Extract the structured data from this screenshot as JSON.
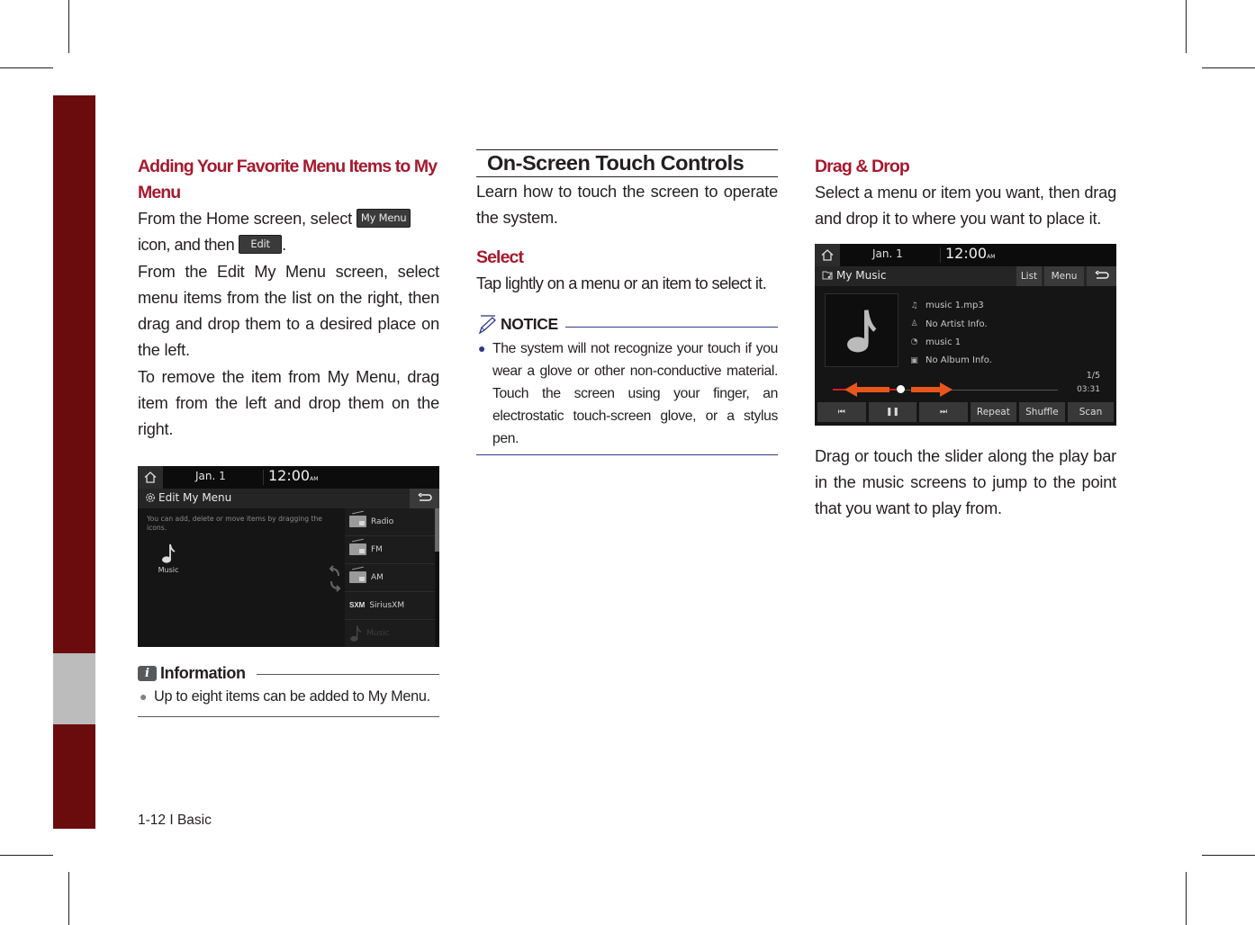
{
  "page": {
    "footer": "1-12 I Basic",
    "colors": {
      "heading_red": "#a6192e",
      "side_tab_red": "#6a0c0e",
      "side_tab_gray": "#bcbcbc",
      "notice_blue": "#2e3a87",
      "screen_bg": "#151515",
      "drag_arrow_orange": "#e8561b"
    }
  },
  "left_column": {
    "heading": "Adding Your Favorite Menu Items to My Menu",
    "para1_before": "From the Home screen, select",
    "my_menu_button": "My Menu",
    "para1_mid": "icon, and then",
    "edit_button": "Edit",
    "para1_end": ".",
    "para2": "From the Edit My Menu screen, select menu items from the list on the right, then drag and drop them to a desired place on the left.",
    "para3": "To remove the item from My Menu, drag item from the left and drop them on the right.",
    "screenshot": {
      "date": "Jan.  1",
      "time": "12:00",
      "ampm": "AM",
      "title": "Edit My Menu",
      "hint": "You can add, delete or move items by dragging the icons.",
      "left_tiles": [
        {
          "label": "Music",
          "icon": "music-note-icon"
        }
      ],
      "list_items": [
        {
          "label": "Radio",
          "icon": "radio-icon",
          "dimmed": false
        },
        {
          "label": "FM",
          "icon": "radio-icon",
          "dimmed": false
        },
        {
          "label": "AM",
          "icon": "radio-icon",
          "dimmed": false
        },
        {
          "label": "SiriusXM",
          "icon": "sxm-logo-icon",
          "logo_text": "SXM",
          "dimmed": false
        },
        {
          "label": "Music",
          "icon": "music-note-icon",
          "dimmed": true
        }
      ]
    },
    "information": {
      "label": "Information",
      "items": [
        "Up to eight items can be added to My Menu."
      ]
    }
  },
  "middle_column": {
    "section_title": "On-Screen Touch Controls",
    "intro": "Learn how to touch the screen to operate the system.",
    "select_heading": "Select",
    "select_text": "Tap lightly on a menu or an item to select it.",
    "notice": {
      "label": "NOTICE",
      "items": [
        "The system will not recognize your touch if you wear a glove or other non-conductive material. Touch the screen using your finger, an electrostatic touch-screen glove, or a stylus pen."
      ]
    }
  },
  "right_column": {
    "heading": "Drag & Drop",
    "intro": "Select a menu or item you want, then drag and drop it to where you want to place it.",
    "screenshot": {
      "date": "Jan.  1",
      "time": "12:00",
      "ampm": "AM",
      "title": "My Music",
      "list_button": "List",
      "menu_button": "Menu",
      "track": [
        {
          "icon": "music-file-icon",
          "glyph": "♫",
          "text": "music 1.mp3"
        },
        {
          "icon": "artist-icon",
          "glyph": "♙",
          "text": "No Artist Info."
        },
        {
          "icon": "title-icon",
          "glyph": "◔",
          "text": "music 1"
        },
        {
          "icon": "album-icon",
          "glyph": "▣",
          "text": "No Album Info."
        }
      ],
      "counter": "1/5",
      "duration": "03:31",
      "progress_fraction": 0.3,
      "controls": [
        {
          "name": "previous-button",
          "label": "⏮",
          "icon": "previous-icon"
        },
        {
          "name": "pause-button",
          "label": "❚❚",
          "icon": "pause-icon"
        },
        {
          "name": "next-button",
          "label": "⏭",
          "icon": "next-icon"
        },
        {
          "name": "repeat-button",
          "label": "Repeat"
        },
        {
          "name": "shuffle-button",
          "label": "Shuffle"
        },
        {
          "name": "scan-button",
          "label": "Scan"
        }
      ]
    },
    "caption": "Drag or touch the slider along the play bar in the music screens to jump to the point that you want to play from."
  }
}
